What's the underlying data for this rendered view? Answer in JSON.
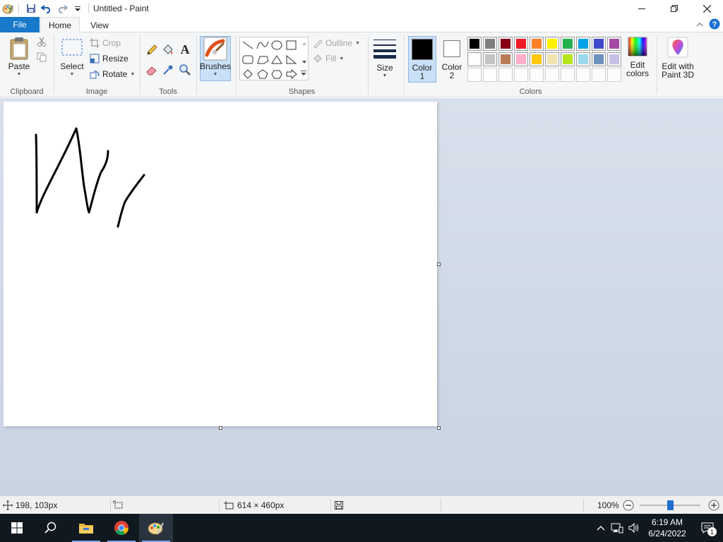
{
  "window": {
    "title": "Untitled - Paint"
  },
  "menu": {
    "file": "File",
    "home": "Home",
    "view": "View"
  },
  "ribbon": {
    "clipboard": {
      "label": "Clipboard",
      "paste": "Paste"
    },
    "image": {
      "label": "Image",
      "select": "Select",
      "crop": "Crop",
      "resize": "Resize",
      "rotate": "Rotate"
    },
    "tools": {
      "label": "Tools"
    },
    "brushes": {
      "label": "Brushes"
    },
    "shapes": {
      "label": "Shapes",
      "outline": "Outline",
      "fill": "Fill"
    },
    "size": {
      "label": "Size"
    },
    "colors": {
      "label": "Colors",
      "color1_line1": "Color",
      "color1_line2": "1",
      "color2_line1": "Color",
      "color2_line2": "2",
      "edit_line1": "Edit",
      "edit_line2": "colors",
      "color1_value": "#000000",
      "color2_value": "#ffffff",
      "palette_row1": [
        "#000000",
        "#7f7f7f",
        "#880015",
        "#ed1c24",
        "#ff7f27",
        "#fff200",
        "#22b14c",
        "#00a2e8",
        "#3f48cc",
        "#a349a4"
      ],
      "palette_row2": [
        "#ffffff",
        "#c3c3c3",
        "#b97a57",
        "#ffaec9",
        "#ffc90e",
        "#efe4b0",
        "#b5e61d",
        "#99d9ea",
        "#7092be",
        "#c8bfe7"
      ]
    },
    "paint3d": {
      "line1": "Edit with",
      "line2": "Paint 3D"
    }
  },
  "status": {
    "cursor_pos": "198, 103px",
    "canvas_size": "614 × 460px",
    "zoom": "100%",
    "zoom_level": 0.5
  },
  "taskbar": {
    "time": "6:19 AM",
    "date": "6/24/2022",
    "notification_count": "1"
  }
}
